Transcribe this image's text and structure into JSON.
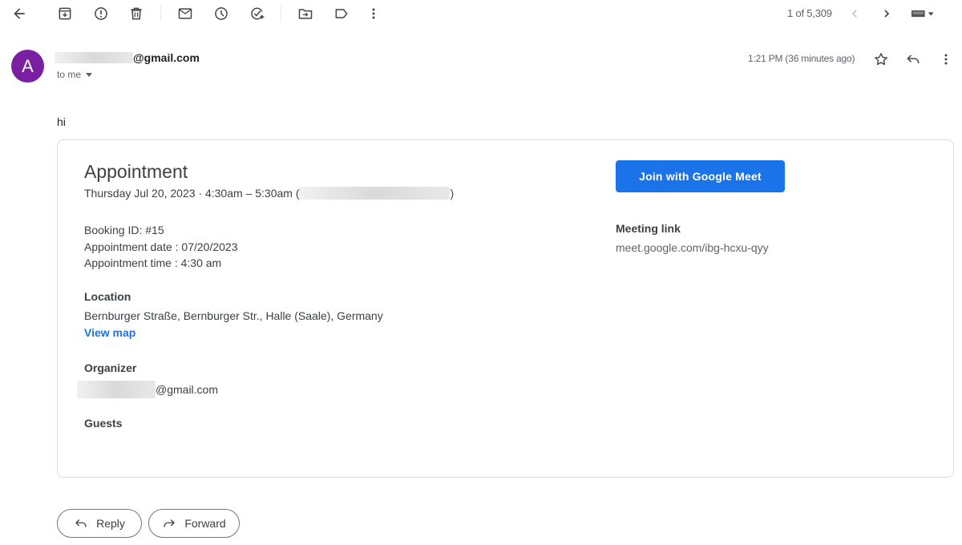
{
  "toolbar": {
    "icons": [
      "back-arrow-icon",
      "archive-icon",
      "report-spam-icon",
      "delete-icon",
      "mark-unread-icon",
      "snooze-icon",
      "add-to-tasks-icon",
      "move-to-icon",
      "label-icon",
      "more-vert-icon"
    ],
    "page_count": "1 of 5,309",
    "nav": [
      "chevron-left-icon",
      "chevron-right-icon"
    ],
    "input_tools": "keyboard-icon"
  },
  "message": {
    "avatar_letter": "A",
    "avatar_color": "#7b1fa2",
    "sender_visible": "@gmail.com",
    "recipient": "to me",
    "timestamp": "1:21 PM (36 minutes ago)",
    "body": "hi"
  },
  "card": {
    "title": "Appointment",
    "when_prefix": "Thursday Jul 20, 2023 · 4:30am – 5:30am (",
    "when_suffix": ")",
    "details": [
      "Booking ID: #15",
      "Appointment date : 07/20/2023",
      "Appointment time : 4:30 am"
    ],
    "location_label": "Location",
    "location": "Bernburger Straße, Bernburger Str., Halle (Saale), Germany",
    "view_map": "View map",
    "organizer_label": "Organizer",
    "organizer_visible": "@gmail.com",
    "guests_label": "Guests",
    "meet_button": "Join with Google Meet",
    "meeting_link_label": "Meeting link",
    "meeting_link": "meet.google.com/ibg-hcxu-qyy",
    "accent": "#1a73e8"
  },
  "actions": {
    "reply": "Reply",
    "forward": "Forward"
  }
}
